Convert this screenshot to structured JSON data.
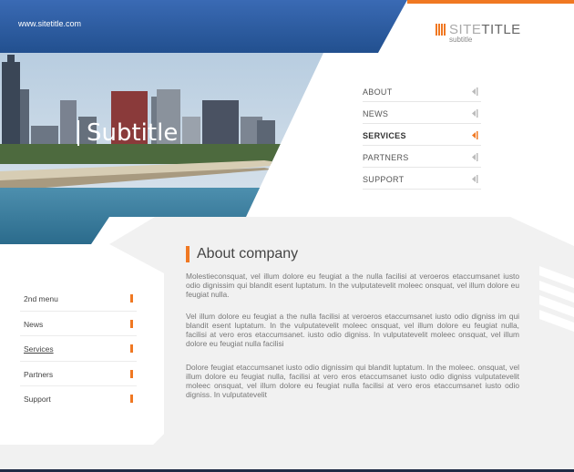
{
  "header": {
    "url": "www.sitetitle.com",
    "logo_title_light": "SITE",
    "logo_title_dark": "TITLE",
    "logo_subtitle": "subtitle",
    "colors": {
      "blue": "#2e5ea8",
      "orange": "#f07822"
    }
  },
  "hero": {
    "subtitle": "Subtitle"
  },
  "topnav": {
    "items": [
      {
        "label": "ABOUT",
        "active": false
      },
      {
        "label": "NEWS",
        "active": false
      },
      {
        "label": "SERVICES",
        "active": true
      },
      {
        "label": "PARTNERS",
        "active": false
      },
      {
        "label": "SUPPORT",
        "active": false
      }
    ]
  },
  "main": {
    "title": "About company",
    "paragraphs": [
      "Molestieconsquat, vel illum dolore eu feugiat a the nulla facilisi at veroeros etaccumsanet iusto odio dignissim qui blandit esent luptatum. In the vulputatevelit moleec onsquat, vel illum dolore eu feugiat nulla.",
      "Vel illum dolore eu feugiat a the nulla facilisi at veroeros etaccumsanet iusto odio digniss im qui blandit esent luptatum. In the vulputatevelit moleec onsquat, vel illum dolore eu feugiat nulla, facilisi at vero eros etaccumsanet. iusto odio digniss. In vulputatevelit moleec onsquat, vel illum dolore eu feugiat nulla facilisi",
      "Dolore feugiat  etaccumsanet iusto odio dignissim qui blandit luptatum. In the moleec. onsquat, vel illum dolore eu feugiat nulla, facilisi at vero eros etaccumsanet iusto odio digniss vulputatevelit moleec onsquat, vel illum dolore eu feugiat nulla facilisi at vero eros etaccumsanet iusto odio digniss. In vulputatevelit"
    ]
  },
  "sidenav": {
    "items": [
      {
        "label": "2nd menu",
        "active": false
      },
      {
        "label": "News",
        "active": false
      },
      {
        "label": "Services",
        "active": true
      },
      {
        "label": "Partners",
        "active": false
      },
      {
        "label": "Support",
        "active": false
      }
    ]
  }
}
